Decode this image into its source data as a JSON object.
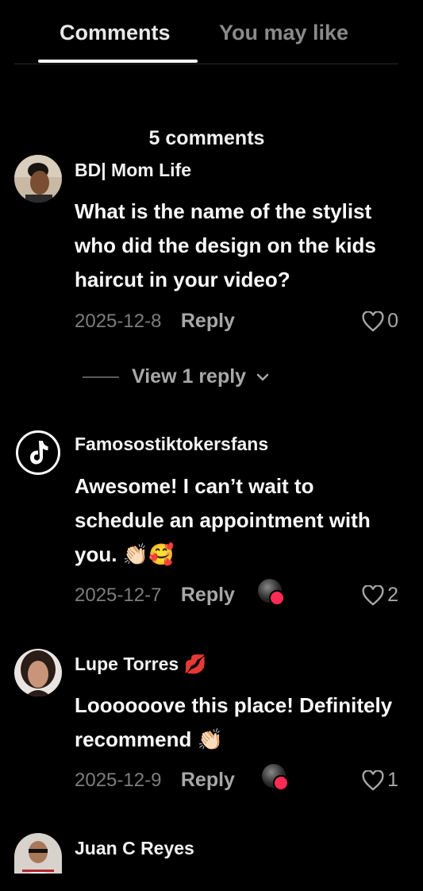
{
  "tabs": {
    "comments": "Comments",
    "you_may_like": "You may like"
  },
  "comments_count": "5 comments",
  "comments": [
    {
      "username": "BD| Mom Life",
      "text": "What is the name of the stylist who did the design on the kids haircut in your video?",
      "date": "2025-12-8",
      "reply": "Reply",
      "likes": "0",
      "view_replies": "View 1 reply"
    },
    {
      "username": "Famosostiktokersfans",
      "text": "Awesome! I can’t wait to schedule an appointment with you. 👏🏻🥰",
      "date": "2025-12-7",
      "reply": "Reply",
      "likes": "2"
    },
    {
      "username": "Lupe Torres 💋",
      "text": "Loooooove this place! Definitely recommend 👏🏻",
      "date": "2025-12-9",
      "reply": "Reply",
      "likes": "1"
    },
    {
      "username": "Juan C Reyes"
    }
  ],
  "colors": {
    "accent": "#fe2c55",
    "muted": "#a8a8a8",
    "date": "#7d7d7d"
  }
}
